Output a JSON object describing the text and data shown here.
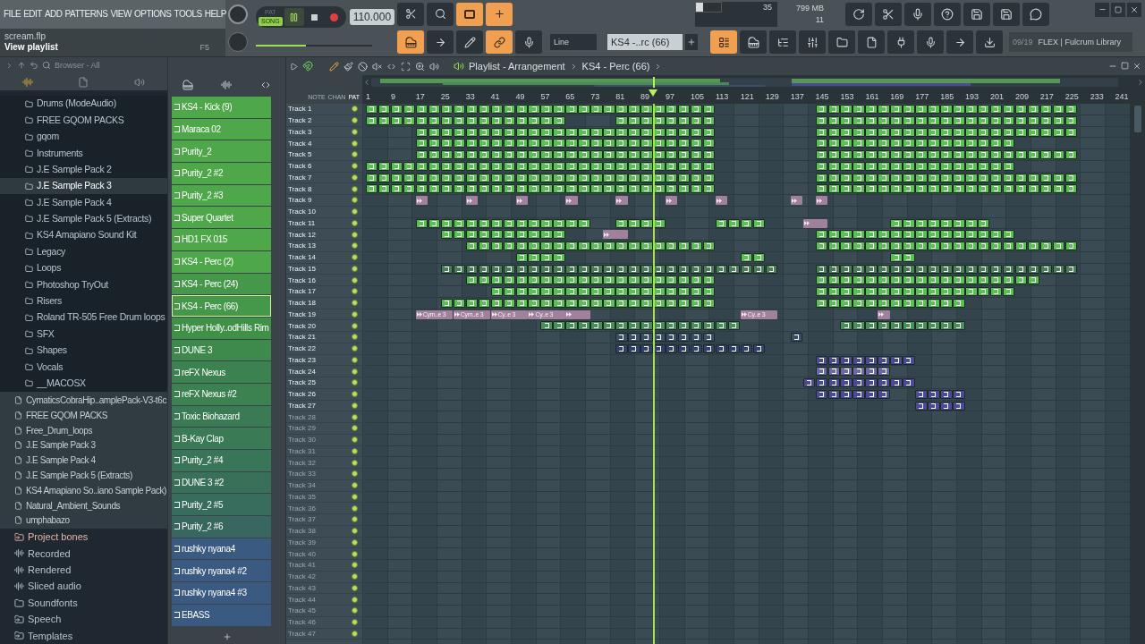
{
  "menu": [
    "FILE",
    "EDIT",
    "ADD",
    "PATTERNS",
    "VIEW",
    "OPTIONS",
    "TOOLS",
    "HELP"
  ],
  "project": {
    "file": "scream.flp",
    "hint": "View playlist",
    "shortcut": "F5"
  },
  "transport": {
    "modes": [
      {
        "label": "PAT",
        "selected": false
      },
      {
        "label": "SONG",
        "selected": true
      }
    ],
    "playing": true,
    "tempo": "110.000",
    "master_volume": {
      "level": 0.43
    }
  },
  "monitor": {
    "cpu": "35",
    "memory": "799 MB",
    "polyphony": "11",
    "cpu_meter": {
      "level": 0.3
    }
  },
  "snap": "Line",
  "pattern_selector": "KS4 -..rc (66)",
  "news": {
    "count": "09/19",
    "text": "FLEX | Fulcrum Library"
  },
  "browser": {
    "title": "Browser - All",
    "folders": [
      {
        "label": "Drums (ModeAudio)",
        "selected": false
      },
      {
        "label": "FREE GQOM PACKS",
        "selected": false
      },
      {
        "label": "gqom",
        "selected": false
      },
      {
        "label": "Instruments",
        "selected": false
      },
      {
        "label": "J.E Sample Pack 2",
        "selected": false
      },
      {
        "label": "J.E Sample Pack 3",
        "selected": true
      },
      {
        "label": "J.E Sample Pack 4",
        "selected": false
      },
      {
        "label": "J.E Sample Pack 5 (Extracts)",
        "selected": false
      },
      {
        "label": "KS4 Amapiano Sound Kit",
        "selected": false
      },
      {
        "label": "Legacy",
        "selected": false
      },
      {
        "label": "Loops",
        "selected": false
      },
      {
        "label": "Photoshop TryOut",
        "selected": false
      },
      {
        "label": "Risers",
        "selected": false
      },
      {
        "label": "Roland TR-505 Free Drum loops",
        "selected": false
      },
      {
        "label": "SFX",
        "selected": false
      },
      {
        "label": "Shapes",
        "selected": false
      },
      {
        "label": "Vocals",
        "selected": false
      },
      {
        "label": "__MACOSX",
        "selected": false
      }
    ],
    "packs": [
      "CymaticsCobraHip..amplePack-V3-t6c",
      "FREE GQOM PACKS",
      "Free_Drum_loops",
      "J.E Sample Pack 3",
      "J.E Sample Pack 4",
      "J.E Sample Pack 5 (Extracts)",
      "KS4 Amapiano So..iano Sample Pack)",
      "Natural_Ambient_Sounds",
      "umphabazo"
    ],
    "categories": [
      {
        "label": "Project bones",
        "kind": "linked",
        "highlighted": true
      },
      {
        "label": "Recorded",
        "kind": "audio",
        "highlighted": false
      },
      {
        "label": "Rendered",
        "kind": "audio",
        "highlighted": false
      },
      {
        "label": "Sliced audio",
        "kind": "audio",
        "highlighted": false
      },
      {
        "label": "Soundfonts",
        "kind": "folder",
        "highlighted": false
      },
      {
        "label": "Speech",
        "kind": "linked",
        "highlighted": false
      },
      {
        "label": "Templates",
        "kind": "linked",
        "highlighted": false
      }
    ]
  },
  "patterns": [
    {
      "name": "KS4 - Kick (9)",
      "color": "#4ea84a",
      "selected": false
    },
    {
      "name": "Maraca 02",
      "color": "#4ea84a",
      "selected": false
    },
    {
      "name": "Purity_2",
      "color": "#4ea84a",
      "selected": false
    },
    {
      "name": "Purity_2 #2",
      "color": "#4ea84a",
      "selected": false
    },
    {
      "name": "Purity_2 #3",
      "color": "#4ea84a",
      "selected": false
    },
    {
      "name": "Super Quartet",
      "color": "#4ea84a",
      "selected": false
    },
    {
      "name": "HD1 FX 015",
      "color": "#4ea84a",
      "selected": false
    },
    {
      "name": "KS4 - Perc (2)",
      "color": "#4ea84a",
      "selected": false
    },
    {
      "name": "KS4 - Perc (24)",
      "color": "#45984a",
      "selected": false
    },
    {
      "name": "KS4 - Perc (66)",
      "color": "#45984a",
      "selected": true
    },
    {
      "name": "Hyper Holly..odHills Rim",
      "color": "#3f9148",
      "selected": false
    },
    {
      "name": "DUNE 3",
      "color": "#3e8a4c",
      "selected": false
    },
    {
      "name": "reFX Nexus",
      "color": "#3c8150",
      "selected": false
    },
    {
      "name": "reFX Nexus #2",
      "color": "#3c8150",
      "selected": false
    },
    {
      "name": "Toxic Biohazard",
      "color": "#3a7a55",
      "selected": false
    },
    {
      "name": "B-Kay Clap",
      "color": "#3a7a55",
      "selected": false
    },
    {
      "name": "Purity_2 #4",
      "color": "#397558",
      "selected": false
    },
    {
      "name": "DUNE 3 #2",
      "color": "#38705a",
      "selected": false
    },
    {
      "name": "Purity_2 #5",
      "color": "#386c5c",
      "selected": false
    },
    {
      "name": "Purity_2 #6",
      "color": "#37675e",
      "selected": false
    },
    {
      "name": "rushky nyana4",
      "color": "#3a5a82",
      "selected": false
    },
    {
      "name": "rushky nyana4 #2",
      "color": "#3a5a82",
      "selected": false
    },
    {
      "name": "rushky nyana4 #3",
      "color": "#3a5a82",
      "selected": false
    },
    {
      "name": "EBASS",
      "color": "#3a5a82",
      "selected": false
    }
  ],
  "playlist": {
    "title": "Playlist - Arrangement",
    "pattern": "KS4 - Perc (66)",
    "modes": [
      "NOTE",
      "CHAN",
      "PAT"
    ],
    "ruler": [
      "1",
      "9",
      "17",
      "25",
      "33",
      "41",
      "49",
      "57",
      "65",
      "73",
      "81",
      "89",
      "97",
      "105",
      "113",
      "121",
      "129",
      "137",
      "145",
      "153",
      "161",
      "169",
      "177",
      "185",
      "193",
      "201",
      "209",
      "217",
      "225",
      "233",
      "241"
    ],
    "song_position": {
      "level": 0.383
    },
    "tracks": [
      {
        "name": "Track 1",
        "empty": false,
        "clips": [
          {
            "kind": "pattern",
            "color": "#5cbf55"
          },
          {
            "kind": "pattern",
            "color": "#5cbf55"
          }
        ]
      },
      {
        "name": "Track 2",
        "empty": false,
        "clips": [
          {
            "kind": "pattern",
            "color": "#5cbf55"
          },
          {
            "kind": "pattern",
            "color": "#5cbf55"
          },
          {
            "kind": "pattern",
            "color": "#5cbf55"
          }
        ]
      },
      {
        "name": "Track 3",
        "empty": false,
        "clips": [
          {
            "kind": "pattern",
            "color": "#5cbf55"
          },
          {
            "kind": "pattern",
            "color": "#5cbf55"
          }
        ]
      },
      {
        "name": "Track 4",
        "empty": false,
        "clips": [
          {
            "kind": "pattern",
            "color": "#5cbf55"
          },
          {
            "kind": "pattern",
            "color": "#5cbf55"
          }
        ]
      },
      {
        "name": "Track 5",
        "empty": false,
        "clips": [
          {
            "kind": "pattern",
            "color": "#5cbf55"
          },
          {
            "kind": "pattern",
            "color": "#5cbf55"
          }
        ]
      },
      {
        "name": "Track 6",
        "empty": false,
        "clips": [
          {
            "kind": "pattern",
            "color": "#5cbf55"
          },
          {
            "kind": "pattern",
            "color": "#5cbf55"
          }
        ]
      },
      {
        "name": "Track 7",
        "empty": false,
        "clips": [
          {
            "kind": "pattern",
            "color": "#5cbf55"
          },
          {
            "kind": "pattern",
            "color": "#5cbf55"
          }
        ]
      },
      {
        "name": "Track 8",
        "empty": false,
        "clips": [
          {
            "kind": "pattern",
            "color": "#5cbf55"
          },
          {
            "kind": "pattern",
            "color": "#5cbf55"
          }
        ]
      },
      {
        "name": "Track 9",
        "empty": false,
        "clips": [
          {
            "kind": "audio",
            "color": "#a0809a"
          },
          {
            "kind": "audio",
            "color": "#a0809a"
          },
          {
            "kind": "audio",
            "color": "#a0809a"
          },
          {
            "kind": "audio",
            "color": "#a0809a"
          },
          {
            "kind": "audio",
            "color": "#a0809a"
          },
          {
            "kind": "audio",
            "color": "#a0809a"
          },
          {
            "kind": "audio",
            "color": "#a0809a"
          },
          {
            "kind": "audio",
            "color": "#a0809a"
          },
          {
            "kind": "audio",
            "color": "#a0809a"
          }
        ]
      },
      {
        "name": "Track 10",
        "empty": false
      },
      {
        "name": "Track 11",
        "empty": false,
        "clips": [
          {
            "kind": "pattern",
            "color": "#5cbf55"
          },
          {
            "kind": "pattern",
            "color": "#5cbf55"
          },
          {
            "kind": "pattern",
            "color": "#5cbf55"
          },
          {
            "kind": "audio",
            "color": "#a0809a"
          },
          {
            "kind": "pattern",
            "color": "#5cbf55"
          }
        ]
      },
      {
        "name": "Track 12",
        "empty": false,
        "clips": [
          {
            "kind": "pattern",
            "color": "#5cbf55"
          },
          {
            "kind": "audio",
            "color": "#a0809a"
          },
          {
            "kind": "pattern",
            "color": "#5cbf55"
          }
        ]
      },
      {
        "name": "Track 13",
        "empty": false,
        "clips": [
          {
            "kind": "pattern",
            "color": "#5cbf55"
          },
          {
            "kind": "pattern",
            "color": "#5cbf55"
          }
        ]
      },
      {
        "name": "Track 14",
        "empty": false,
        "clips": [
          {
            "kind": "pattern",
            "color": "#5cbf55"
          },
          {
            "kind": "pattern",
            "color": "#5cbf55"
          },
          {
            "kind": "pattern",
            "color": "#5cbf55"
          }
        ]
      },
      {
        "name": "Track 15",
        "empty": false,
        "clips": [
          {
            "kind": "pattern",
            "color": "#4a7e5a"
          },
          {
            "kind": "pattern",
            "color": "#4a7e5a"
          }
        ]
      },
      {
        "name": "Track 16",
        "empty": false,
        "clips": [
          {
            "kind": "pattern",
            "color": "#5cbf55"
          },
          {
            "kind": "pattern",
            "color": "#5cbf55"
          }
        ]
      },
      {
        "name": "Track 17",
        "empty": false,
        "clips": [
          {
            "kind": "pattern",
            "color": "#5cbf55"
          },
          {
            "kind": "pattern",
            "color": "#5cbf55"
          }
        ]
      },
      {
        "name": "Track 18",
        "empty": false,
        "clips": [
          {
            "kind": "pattern",
            "color": "#5cbf55"
          },
          {
            "kind": "pattern",
            "color": "#5cbf55"
          }
        ]
      },
      {
        "name": "Track 19",
        "empty": false,
        "clips": [
          {
            "kind": "audio",
            "color": "#a0809a",
            "label": "Cym..e 3"
          },
          {
            "kind": "audio",
            "color": "#a0809a",
            "label": "Cym..e 3"
          },
          {
            "kind": "audio",
            "color": "#a0809a",
            "label": "Cy..e 3"
          },
          {
            "kind": "audio",
            "color": "#a0809a",
            "label": "Cy..e 3"
          },
          {
            "kind": "audio",
            "color": "#a0809a"
          },
          {
            "kind": "audio",
            "color": "#a0809a",
            "label": "Cy..e 3"
          },
          {
            "kind": "audio",
            "color": "#a0809a"
          }
        ]
      },
      {
        "name": "Track 20",
        "empty": false,
        "clips": [
          {
            "kind": "pattern",
            "color": "#4b8e5c"
          },
          {
            "kind": "pattern",
            "color": "#4b8e5c"
          }
        ]
      },
      {
        "name": "Track 21",
        "empty": false,
        "clips": [
          {
            "kind": "pattern",
            "color": "#3b4e6e"
          },
          {
            "kind": "pattern",
            "color": "#3b4e6e"
          }
        ]
      },
      {
        "name": "Track 22",
        "empty": false,
        "clips": [
          {
            "kind": "pattern",
            "color": "#33406e"
          }
        ]
      },
      {
        "name": "Track 23",
        "empty": false,
        "clips": [
          {
            "kind": "pattern",
            "color": "#4a4a96"
          }
        ]
      },
      {
        "name": "Track 24",
        "empty": false,
        "clips": [
          {
            "kind": "pattern",
            "color": "#6a6aa8"
          }
        ]
      },
      {
        "name": "Track 25",
        "empty": false,
        "clips": [
          {
            "kind": "pattern",
            "color": "#4a4a96"
          }
        ]
      },
      {
        "name": "Track 26",
        "empty": false,
        "clips": [
          {
            "kind": "pattern",
            "color": "#4a4a96"
          },
          {
            "kind": "pattern",
            "color": "#4a4a96"
          }
        ]
      },
      {
        "name": "Track 27",
        "empty": false,
        "clips": [
          {
            "kind": "pattern",
            "color": "#4a4a96"
          }
        ]
      },
      {
        "name": "Track 28",
        "empty": true
      },
      {
        "name": "Track 29",
        "empty": true
      },
      {
        "name": "Track 30",
        "empty": true
      },
      {
        "name": "Track 31",
        "empty": true
      },
      {
        "name": "Track 32",
        "empty": true
      },
      {
        "name": "Track 33",
        "empty": true
      },
      {
        "name": "Track 34",
        "empty": true
      },
      {
        "name": "Track 35",
        "empty": true
      },
      {
        "name": "Track 36",
        "empty": true
      },
      {
        "name": "Track 37",
        "empty": true
      },
      {
        "name": "Track 38",
        "empty": true
      },
      {
        "name": "Track 39",
        "empty": true
      },
      {
        "name": "Track 40",
        "empty": true
      },
      {
        "name": "Track 41",
        "empty": true
      },
      {
        "name": "Track 42",
        "empty": true
      },
      {
        "name": "Track 43",
        "empty": true
      },
      {
        "name": "Track 44",
        "empty": true
      },
      {
        "name": "Track 45",
        "empty": true
      },
      {
        "name": "Track 46",
        "empty": true
      },
      {
        "name": "Track 47",
        "empty": true
      }
    ]
  }
}
